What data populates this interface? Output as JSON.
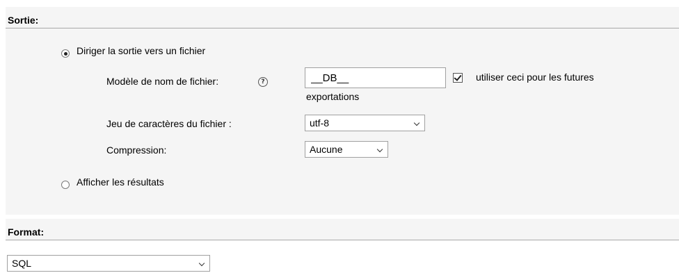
{
  "sortie": {
    "title": "Sortie:",
    "file_option": {
      "label": "Diriger la sortie vers un fichier",
      "selected": true
    },
    "filename_template": {
      "label": "Modèle de nom de fichier:",
      "help_icon": "help-icon",
      "value": "__DB__",
      "remember_checked": true,
      "remember_label_line1": "utiliser ceci pour les futures",
      "remember_label_line2": "exportations"
    },
    "charset": {
      "label": "Jeu de caractères du fichier :",
      "selected": "utf-8"
    },
    "compression": {
      "label": "Compression:",
      "selected": "Aucune"
    },
    "display_option": {
      "label": "Afficher les résultats",
      "selected": false
    }
  },
  "format": {
    "title": "Format:",
    "selected": "SQL"
  }
}
